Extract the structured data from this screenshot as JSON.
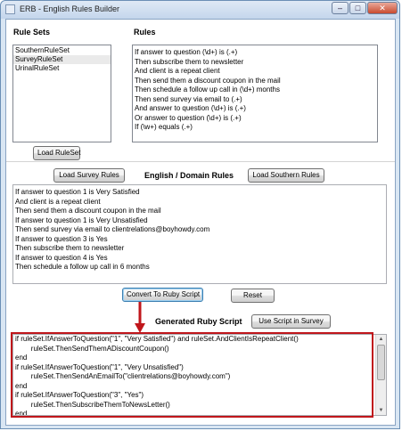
{
  "window": {
    "title": "ERB - English Rules Builder",
    "controls": {
      "minimize": "–",
      "maximize": "□",
      "close": "✕"
    }
  },
  "rule_sets": {
    "label": "Rule Sets",
    "items": [
      {
        "label": "SouthernRuleSet"
      },
      {
        "label": "SurveyRuleSet"
      },
      {
        "label": "UrinalRuleSet"
      }
    ],
    "selected": "SurveyRuleSet",
    "load_button": "Load RuleSet"
  },
  "rules": {
    "label": "Rules",
    "lines": [
      "If answer to question (\\d+) is (.+)",
      "Then subscribe them to newsletter",
      "And client is a repeat client",
      "Then send them a discount coupon in the mail",
      "Then schedule a follow up call in (\\d+) months",
      "Then send survey via email to (.+)",
      "And answer to question (\\d+) is (.+)",
      "Or answer to question (\\d+) is (.+)",
      "If (\\w+) equals (.+)"
    ]
  },
  "english_domain": {
    "load_survey_button": "Load Survey Rules",
    "label": "English / Domain Rules",
    "load_southern_button": "Load Southern Rules",
    "lines": [
      "If answer to question 1 is Very Satisfied",
      "And client is a repeat client",
      "Then send them a discount coupon in the mail",
      "If answer to question 1 is Very Unsatisfied",
      "Then send survey via email to clientrelations@boyhowdy.com",
      "If answer to question 3 is Yes",
      "Then subscribe them to newsletter",
      "If answer to question 4 is Yes",
      "Then schedule a follow up call in 6 months"
    ]
  },
  "actions": {
    "convert_button": "Convert To Ruby Script",
    "reset_button": "Reset"
  },
  "ruby": {
    "label": "Generated Ruby Script",
    "use_button": "Use Script in Survey",
    "lines": [
      "if ruleSet.IfAnswerToQuestion(\"1\", \"Very Satisfied\") and ruleSet.AndClientIsRepeatClient()",
      "        ruleSet.ThenSendThemADiscountCoupon()",
      "end",
      "if ruleSet.IfAnswerToQuestion(\"1\", \"Very Unsatisfied\")",
      "        ruleSet.ThenSendAnEmailTo(\"clientrelations@boyhowdy.com\")",
      "end",
      "if ruleSet.IfAnswerToQuestion(\"3\", \"Yes\")",
      "        ruleSet.ThenSubscribeThemToNewsLetter()",
      "end"
    ]
  },
  "colors": {
    "annotation_red": "#c0161b",
    "focus_blue": "#3c7fb1"
  }
}
